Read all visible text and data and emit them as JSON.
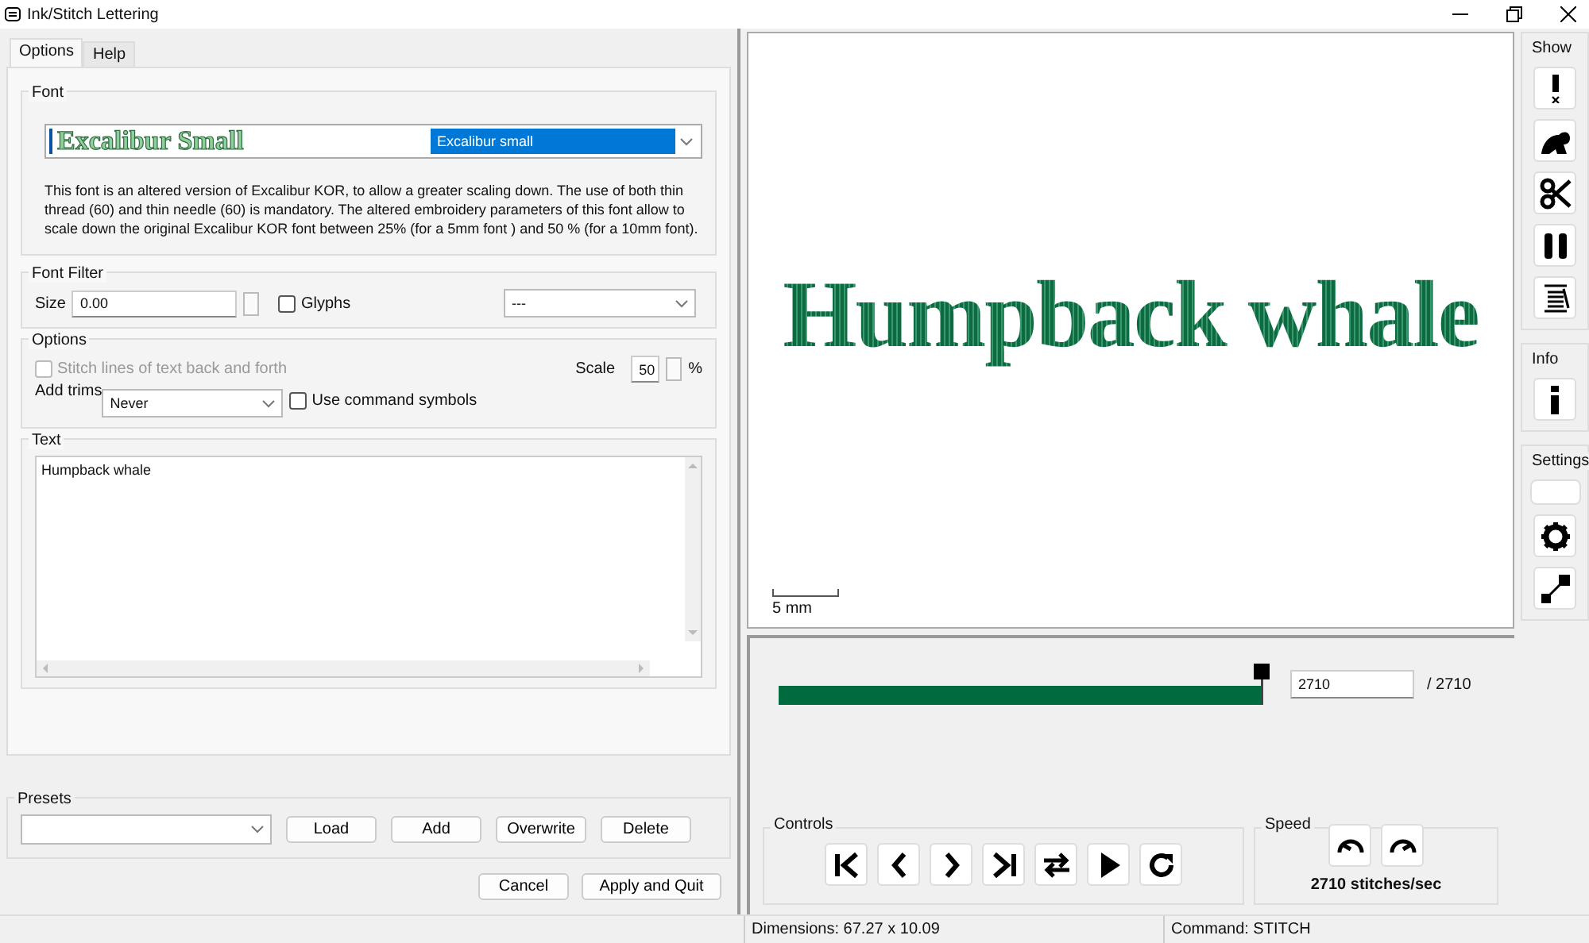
{
  "window": {
    "title": "Ink/Stitch Lettering"
  },
  "tabs": [
    {
      "label": "Options",
      "selected": true
    },
    {
      "label": "Help",
      "selected": false
    }
  ],
  "font_group": {
    "title": "Font",
    "font_sample": "Excalibur Small",
    "font_name": "Excalibur small",
    "description": "This font is an altered version  of Excalibur KOR, to allow a greater scaling down. The use of both thin thread (60) and thin needle (60) is mandatory. The altered embroidery parameters of this font allow to scale down the original Excalibur KOR font between 25% (for a 5mm font ) and 50 % (for a 10mm font)."
  },
  "font_filter": {
    "title": "Font Filter",
    "size_label": "Size",
    "size_value": "0.00",
    "glyphs": {
      "label": "Glyphs",
      "checked": false
    },
    "filter_value": "---"
  },
  "options": {
    "title": "Options",
    "back_and_forth": {
      "label": "Stitch lines of text back and forth",
      "checked": false,
      "disabled": true
    },
    "scale_label": "Scale",
    "scale_value": "50",
    "scale_unit": "%",
    "trims_label": "Add trims",
    "trims_value": "Never",
    "command_symbols": {
      "label": "Use command symbols",
      "checked": false,
      "disabled": false
    }
  },
  "text_group": {
    "title": "Text",
    "value": "Humpback whale"
  },
  "presets": {
    "title": "Presets",
    "buttons": [
      "Load",
      "Add",
      "Overwrite",
      "Delete"
    ]
  },
  "dialog_buttons": [
    "Cancel",
    "Apply and Quit"
  ],
  "preview": {
    "stitched_text": "Humpback whale",
    "scale_label": "5 mm"
  },
  "stitch_slider": {
    "level": 1,
    "current": "2710",
    "total": "/ 2710"
  },
  "controls": {
    "title": "Controls",
    "buttons": [
      {
        "kind": "first"
      },
      {
        "kind": "previous"
      },
      {
        "kind": "next"
      },
      {
        "kind": "last"
      },
      {
        "kind": "direction"
      },
      {
        "kind": "play"
      },
      {
        "kind": "restart"
      }
    ]
  },
  "speed": {
    "title": "Speed",
    "buttons": [
      {
        "kind": "slower"
      },
      {
        "kind": "faster"
      }
    ],
    "reading": "2710 stitches/sec"
  },
  "toolbar": [
    {
      "title": "Show",
      "buttons": [
        {
          "kind": "warning"
        },
        {
          "kind": "jump"
        },
        {
          "kind": "trim"
        },
        {
          "kind": "stop"
        },
        {
          "kind": "thread"
        }
      ]
    },
    {
      "title": "Info",
      "buttons": [
        {
          "kind": "info"
        }
      ]
    },
    {
      "title": "Settings",
      "buttons": [
        {
          "kind": "blank"
        },
        {
          "kind": "settings"
        },
        {
          "kind": "resize"
        }
      ]
    }
  ],
  "status_bar": [
    "Dimensions: 67.27 x 10.09",
    "Command: STITCH"
  ]
}
